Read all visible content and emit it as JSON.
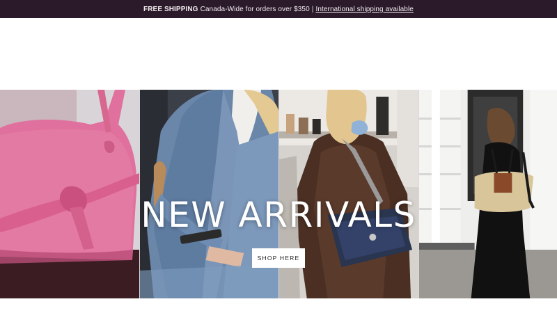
{
  "announcement": {
    "bold": "FREE SHIPPING",
    "text": "Canada-Wide for orders over $350",
    "separator": "|",
    "link": "International shipping available",
    "bg_color": "#2a1a2a"
  },
  "hero": {
    "title": "NEW ARRIVALS",
    "button": "SHOP HERE",
    "panels": [
      "pink-bag-photo",
      "denim-jacket-photo",
      "quilted-bag-photo",
      "straw-tote-photo"
    ]
  }
}
